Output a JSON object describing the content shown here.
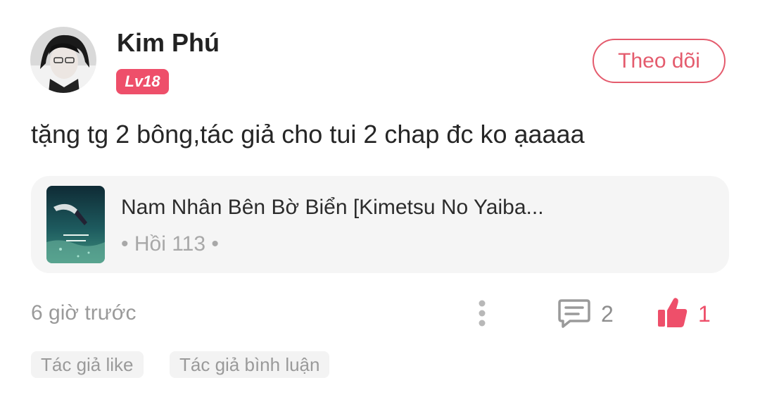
{
  "user": {
    "name": "Kim Phú",
    "level": "Lv18"
  },
  "follow_button": {
    "label": "Theo dõi"
  },
  "comment": {
    "text": "tặng tg 2 bông,tác giả cho tui 2 chap đc ko ạaaaa"
  },
  "story_card": {
    "title": "Nam Nhân Bên Bờ Biển [Kimetsu No Yaiba...",
    "chapter": "• Hồi 113 •"
  },
  "footer": {
    "timestamp": "6 giờ trước",
    "comment_count": "2",
    "like_count": "1"
  },
  "tags": [
    "Tác giả like",
    "Tác giả bình luận"
  ],
  "colors": {
    "accent": "#ee4f6a",
    "follow_border": "#e45b6d",
    "card_bg": "#f5f5f5",
    "muted_text": "#9a9a9a"
  },
  "icons": [
    "avatar-image",
    "more-vertical-icon",
    "comment-icon",
    "thumbs-up-icon"
  ]
}
